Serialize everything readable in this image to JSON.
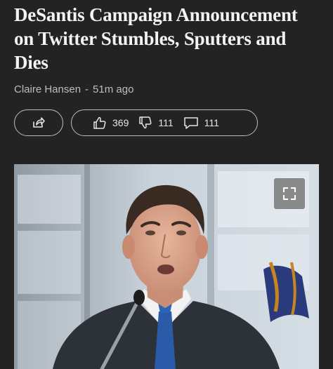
{
  "article": {
    "headline": "DeSantis Campaign Announcement on Twitter Stumbles, Sputters and Dies",
    "author": "Claire Hansen",
    "separator": "-",
    "time_ago": "51m ago"
  },
  "actions": {
    "share_icon": "share-icon",
    "likes": "369",
    "dislikes": "111",
    "comments": "111"
  },
  "image": {
    "subject": "Man in dark suit and blue tie speaking at a microphone",
    "expand_icon": "expand-icon"
  },
  "colors": {
    "background": "#232323",
    "text": "#f3f3f3",
    "muted": "#bdbdbd",
    "border": "#bcbcbc"
  }
}
